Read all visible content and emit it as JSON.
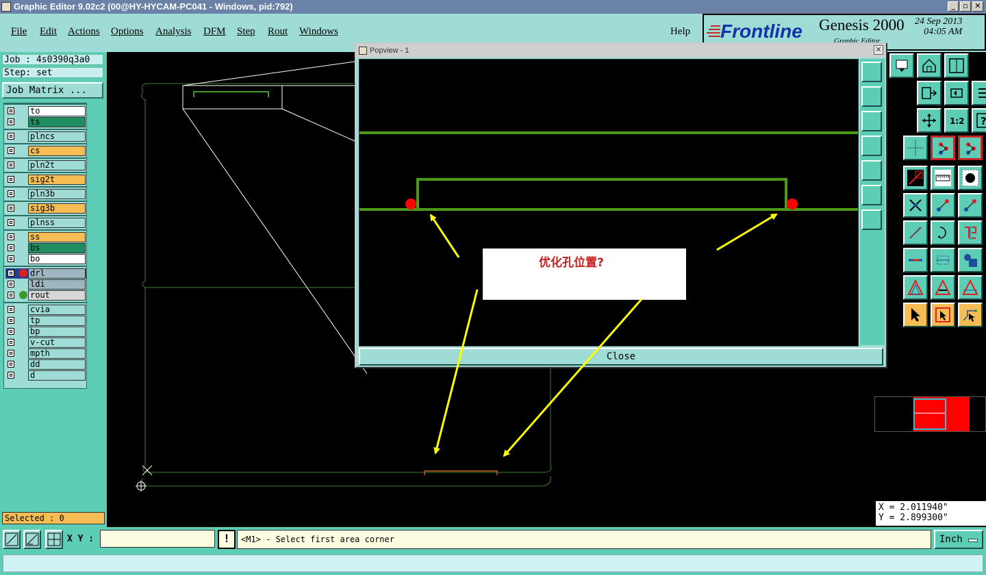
{
  "window": {
    "title": "Graphic Editor 9.02c2 (00@HY-HYCAM-PC041 - Windows, pid:792)",
    "buttons": [
      "_",
      "▫",
      "✕"
    ]
  },
  "menu": {
    "items": [
      "File",
      "Edit",
      "Actions",
      "Options",
      "Analysis",
      "DFM",
      "Step",
      "Rout",
      "Windows"
    ],
    "help": "Help"
  },
  "brand": {
    "logo": "Frontline",
    "product": "Genesis 2000",
    "date": "24 Sep 2013",
    "time": "04:05 AM",
    "subtitle": "Graphic Editor"
  },
  "job": {
    "job": "Job : 4s0390q3a0",
    "step": "Step: set",
    "matrix_button": "Job Matrix ..."
  },
  "layers": [
    {
      "name": "to",
      "color": "#ffffff"
    },
    {
      "name": "ts",
      "color": "#1f8f62"
    },
    {
      "name": "plncs",
      "color": "#9fdcd6"
    },
    {
      "name": "cs",
      "color": "#f6bd55"
    },
    {
      "name": "pln2t",
      "color": "#9fdcd6"
    },
    {
      "name": "sig2t",
      "color": "#f6bd55"
    },
    {
      "name": "pln3b",
      "color": "#9fdcd6"
    },
    {
      "name": "sig3b",
      "color": "#f6bd55"
    },
    {
      "name": "plnss",
      "color": "#9fdcd6"
    },
    {
      "name": "ss",
      "color": "#f6bd55"
    },
    {
      "name": "bs",
      "color": "#1f8f62"
    },
    {
      "name": "bo",
      "color": "#ffffff"
    },
    {
      "name": "drl",
      "color": "#9fb5c0"
    },
    {
      "name": "ldi",
      "color": "#9fb5c0"
    },
    {
      "name": "rout",
      "color": "#d8d8d8"
    },
    {
      "name": "cvia",
      "color": "#9fdcd6"
    },
    {
      "name": "tp",
      "color": "#9fdcd6"
    },
    {
      "name": "bp",
      "color": "#9fdcd6"
    },
    {
      "name": "v-cut",
      "color": "#9fdcd6"
    },
    {
      "name": "mpth",
      "color": "#9fdcd6"
    },
    {
      "name": "dd",
      "color": "#9fdcd6"
    },
    {
      "name": "d",
      "color": "#9fdcd6"
    }
  ],
  "selected": "Selected : 0",
  "popview": {
    "title": "Popview - 1",
    "close_label": "Close"
  },
  "annotation": "优化孔位置?",
  "coords": {
    "x": "X = 2.011940\"",
    "y": "Y = 2.899300\""
  },
  "bottom": {
    "xy_label": "X Y :",
    "xy_value": "",
    "bang": "!",
    "prompt": "<M1> - Select first area corner",
    "units": "Inch"
  }
}
